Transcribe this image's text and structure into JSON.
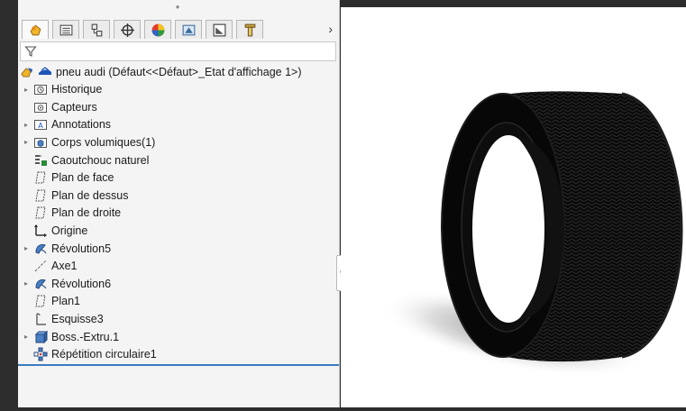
{
  "toolbar": {
    "tabs": [
      {
        "icon": "feature-manager-icon"
      },
      {
        "icon": "property-manager-icon"
      },
      {
        "icon": "configuration-manager-icon"
      },
      {
        "icon": "dimxpert-manager-icon"
      },
      {
        "icon": "display-manager-icon"
      },
      {
        "icon": "cam-manager-icon"
      },
      {
        "icon": "simulation-manager-icon"
      },
      {
        "icon": "analysis-manager-icon"
      }
    ],
    "more": "›"
  },
  "tree": {
    "root": "pneu audi  (Défaut<<Défaut>_Etat d'affichage 1>)",
    "items": [
      {
        "label": "Historique",
        "expandable": true,
        "icon": "history-folder-icon"
      },
      {
        "label": "Capteurs",
        "expandable": false,
        "icon": "sensors-folder-icon"
      },
      {
        "label": "Annotations",
        "expandable": true,
        "icon": "annotations-folder-icon"
      },
      {
        "label": "Corps volumiques(1)",
        "expandable": true,
        "icon": "solid-bodies-folder-icon"
      },
      {
        "label": "Caoutchouc naturel",
        "expandable": false,
        "icon": "material-icon"
      },
      {
        "label": "Plan de face",
        "expandable": false,
        "icon": "plane-icon"
      },
      {
        "label": "Plan de dessus",
        "expandable": false,
        "icon": "plane-icon"
      },
      {
        "label": "Plan de droite",
        "expandable": false,
        "icon": "plane-icon"
      },
      {
        "label": "Origine",
        "expandable": false,
        "icon": "origin-icon"
      },
      {
        "label": "Révolution5",
        "expandable": true,
        "icon": "revolve-icon"
      },
      {
        "label": "Axe1",
        "expandable": false,
        "icon": "axis-icon"
      },
      {
        "label": "Révolution6",
        "expandable": true,
        "icon": "revolve-icon"
      },
      {
        "label": "Plan1",
        "expandable": false,
        "icon": "plane-icon"
      },
      {
        "label": "Esquisse3",
        "expandable": false,
        "icon": "sketch-icon"
      },
      {
        "label": "Boss.-Extru.1",
        "expandable": true,
        "icon": "extrude-icon"
      },
      {
        "label": "Répétition circulaire1",
        "expandable": false,
        "icon": "circular-pattern-icon"
      }
    ]
  },
  "colors": {
    "accent": "#3b7bbd",
    "tire": "#0b0b0b",
    "panel_bg": "#f4f4f4"
  }
}
